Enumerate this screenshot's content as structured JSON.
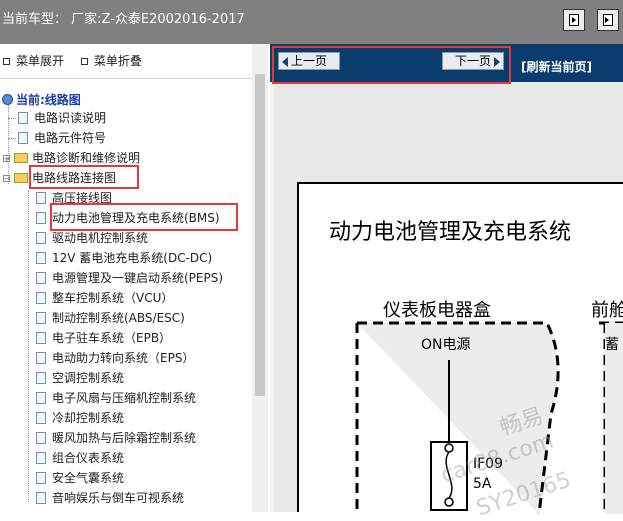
{
  "titlebar": {
    "text": "当前车型：  厂家:Z-众泰E2002016-2017"
  },
  "left": {
    "expand_label": "菜单展开",
    "collapse_label": "菜单折叠",
    "tree": {
      "current": "当前:线路图",
      "items": [
        "电路识读说明",
        "电路元件符号",
        "电路诊断和维修说明",
        "电路线路连接图",
        "高压接线图",
        "动力电池管理及充电系统(BMS)",
        "驱动电机控制系统",
        "12V 蓄电池充电系统(DC-DC)",
        "电源管理及一键启动系统(PEPS)",
        "整车控制系统（VCU）",
        "制动控制系统(ABS/ESC)",
        "电子驻车系统（EPB）",
        "电动助力转向系统（EPS）",
        "空调控制系统",
        "电子风扇与压缩机控制系统",
        "冷却控制系统",
        "暖风加热与后除霜控制系统",
        "组合仪表系统",
        "安全气囊系统",
        "音响娱乐与倒车可视系统"
      ]
    }
  },
  "right": {
    "prev_label": "上一页",
    "next_label": "下一页",
    "refresh_label": "[刷新当前页]",
    "diagram": {
      "title": "动力电池管理及充电系统",
      "box_left": "仪表板电器盒",
      "box_right": "前舱",
      "on_power": "ON电源",
      "right_small": "蓄",
      "fuse_id": "IF09",
      "fuse_rating": "5A"
    },
    "watermark": [
      "畅易",
      "car88.com",
      "SY20165"
    ]
  },
  "colors": {
    "titlebar": "#808080",
    "navbar": "#0a3d6e",
    "highlight": "#e23a3a",
    "current_link": "#1a3ea8"
  }
}
